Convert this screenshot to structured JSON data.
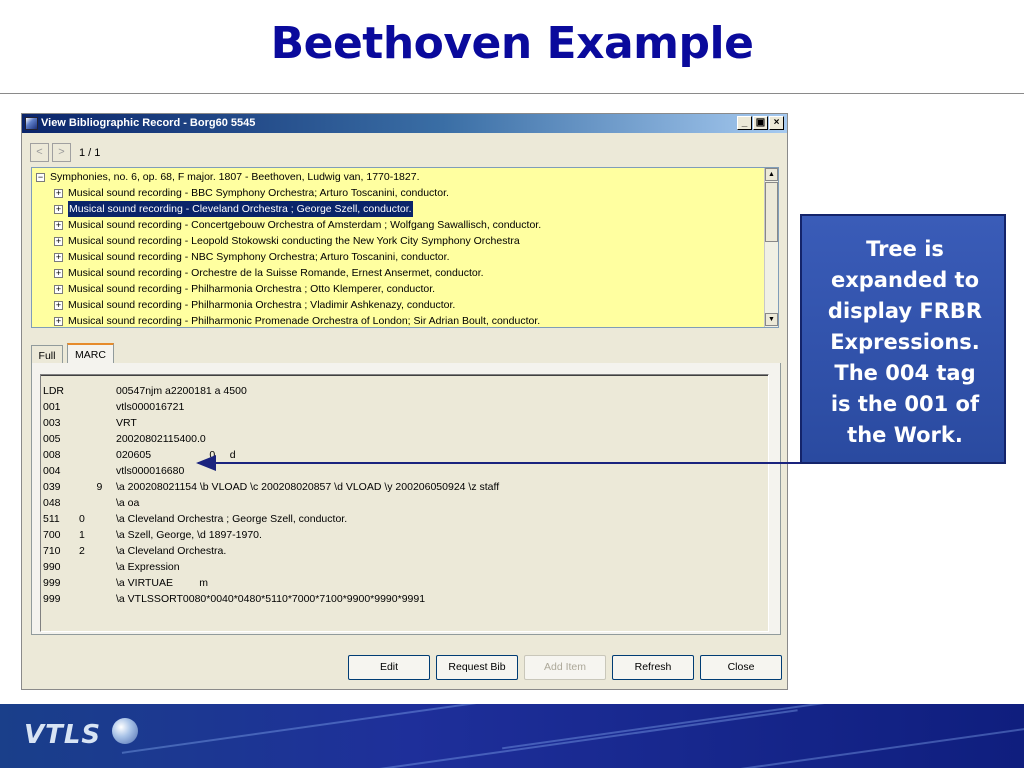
{
  "slide": {
    "title": "Beethoven Example",
    "callout": "Tree is\nexpanded to\ndisplay FRBR\nExpressions.\nThe 004 tag\nis the 001 of\nthe Work.",
    "footer_logo": "VTLS"
  },
  "window": {
    "title": "View Bibliographic Record - Borg60 5545",
    "controls": {
      "minimize": "_",
      "restore": "▣",
      "close": "×"
    },
    "nav": {
      "prev": "<",
      "next": ">",
      "counter": "1 / 1"
    }
  },
  "tree": {
    "root": {
      "toggle": "−",
      "label": "Symphonies, no. 6, op. 68, F major. 1807 - Beethoven, Ludwig van, 1770-1827."
    },
    "items": [
      {
        "toggle": "+",
        "label": "Musical sound recording - BBC Symphony Orchestra; Arturo Toscanini, conductor.",
        "selected": false
      },
      {
        "toggle": "+",
        "label": "Musical sound recording - Cleveland Orchestra ; George Szell, conductor.",
        "selected": true
      },
      {
        "toggle": "+",
        "label": "Musical sound recording - Concertgebouw Orchestra of Amsterdam ; Wolfgang Sawallisch, conductor.",
        "selected": false
      },
      {
        "toggle": "+",
        "label": "Musical sound recording - Leopold Stokowski conducting the New York City Symphony Orchestra",
        "selected": false
      },
      {
        "toggle": "+",
        "label": "Musical sound recording - NBC Symphony Orchestra; Arturo Toscanini, conductor.",
        "selected": false
      },
      {
        "toggle": "+",
        "label": "Musical sound recording - Orchestre de la Suisse Romande, Ernest Ansermet, conductor.",
        "selected": false
      },
      {
        "toggle": "+",
        "label": "Musical sound recording - Philharmonia Orchestra ; Otto Klemperer, conductor.",
        "selected": false
      },
      {
        "toggle": "+",
        "label": "Musical sound recording - Philharmonia Orchestra ; Vladimir Ashkenazy, conductor.",
        "selected": false
      },
      {
        "toggle": "+",
        "label": "Musical sound recording - Philharmonic Promenade Orchestra of London; Sir Adrian Boult, conductor.",
        "selected": false
      }
    ],
    "scroll_up": "▲",
    "scroll_down": "▼"
  },
  "tabs": [
    {
      "label": "Full",
      "active": false
    },
    {
      "label": "MARC",
      "active": true
    }
  ],
  "marc": [
    {
      "tag": "LDR",
      "ind": "",
      "value": "00547njm a2200181 a 4500"
    },
    {
      "tag": "001",
      "ind": "",
      "value": "vtls000016721"
    },
    {
      "tag": "003",
      "ind": "",
      "value": "VRT"
    },
    {
      "tag": "005",
      "ind": "",
      "value": "20020802115400.0"
    },
    {
      "tag": "008",
      "ind": "",
      "value": "020605                    0     d"
    },
    {
      "tag": "004",
      "ind": "",
      "value": "vtls000016680"
    },
    {
      "tag": "039",
      "ind": "      9",
      "value": "\\a 200208021154 \\b VLOAD \\c 200208020857 \\d VLOAD \\y 200206050924 \\z staff"
    },
    {
      "tag": "048",
      "ind": "",
      "value": "\\a oa"
    },
    {
      "tag": "511",
      "ind": "0",
      "value": "\\a Cleveland Orchestra ; George Szell, conductor."
    },
    {
      "tag": "700",
      "ind": "1",
      "value": "\\a Szell, George, \\d 1897-1970."
    },
    {
      "tag": "710",
      "ind": "2",
      "value": "\\a Cleveland Orchestra."
    },
    {
      "tag": "990",
      "ind": "",
      "value": "\\a Expression"
    },
    {
      "tag": "999",
      "ind": "",
      "value": "\\a VIRTUAE         m"
    },
    {
      "tag": "999",
      "ind": "",
      "value": "\\a VTLSSORT0080*0040*0480*5110*7000*7100*9900*9990*9991"
    }
  ],
  "buttons": [
    {
      "label": "Edit",
      "enabled": true
    },
    {
      "label": "Request Bib",
      "enabled": true
    },
    {
      "label": "Add Item",
      "enabled": false
    },
    {
      "label": "Refresh",
      "enabled": true
    },
    {
      "label": "Close",
      "enabled": true
    }
  ],
  "colors": {
    "title": "#0a0a9c",
    "tree_background": "#ffffa0",
    "selection": "#0a246a",
    "callout": "#3152a8",
    "arrow": "#1a237e"
  }
}
